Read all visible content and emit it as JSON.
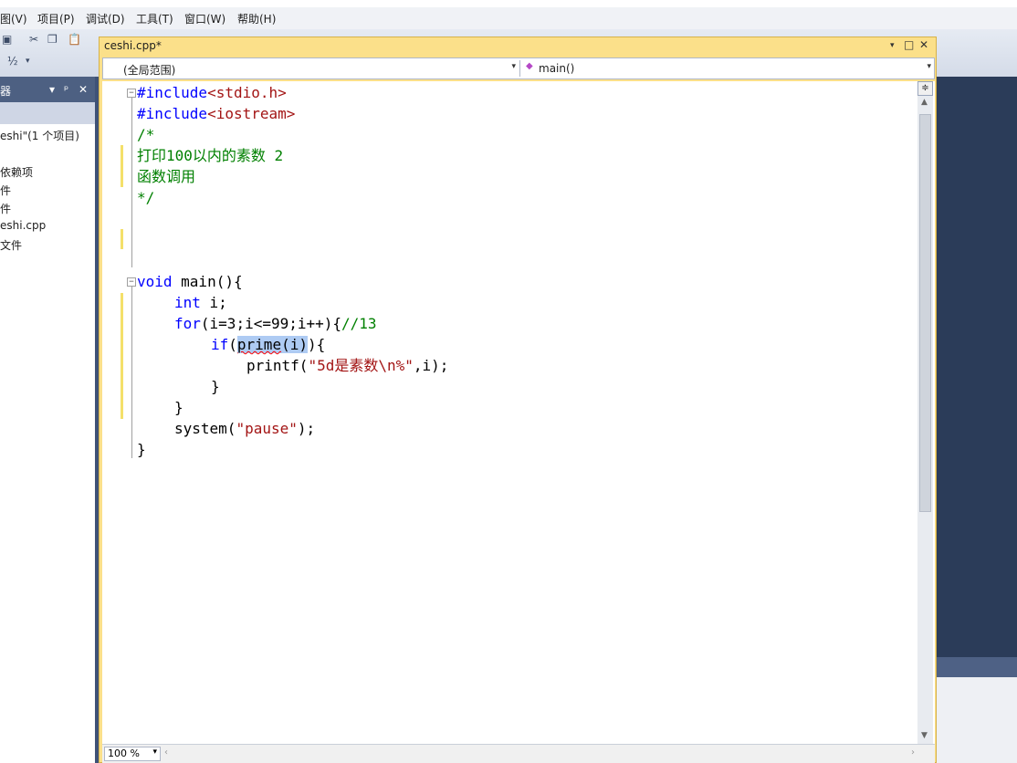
{
  "menu": [
    "图(V)",
    "项目(P)",
    "调试(D)",
    "工具(T)",
    "窗口(W)",
    "帮助(H)"
  ],
  "solution_explorer": {
    "title": "器",
    "items": [
      "eshi\"(1 个项目)",
      "依赖项",
      "件",
      "件",
      "eshi.cpp",
      "文件"
    ]
  },
  "document": {
    "tab_title": "ceshi.cpp*",
    "scope_combo": "(全局范围)",
    "member_combo": "main()",
    "zoom": "100 %"
  },
  "code": {
    "line1_kw": "#include",
    "line1_hdr": "<stdio.h>",
    "line2_kw": "#include",
    "line2_hdr": "<iostream>",
    "line3": "/*",
    "line4": "打印100以内的素数 2",
    "line5": "函数调用",
    "line6": "*/",
    "line10_kw": "void",
    "line10_rest": " main(){",
    "line11_kw": "int",
    "line11_rest": " i;",
    "line12_kw": "for",
    "line12_rest": "(i=3;i<=99;i++){",
    "line12_cm": "//13",
    "line13_kw": "if",
    "line13_open": "(",
    "line13_fn": "prime",
    "line13_arg": "(i)",
    "line13_close": "){",
    "line14_fn": "printf(",
    "line14_str": "\"5d是素数\\n%\"",
    "line14_rest": ",i);",
    "line15": "}",
    "line16": "}",
    "line17_fn": "system(",
    "line17_str": "\"pause\"",
    "line17_rest": ");",
    "line18": "}"
  }
}
